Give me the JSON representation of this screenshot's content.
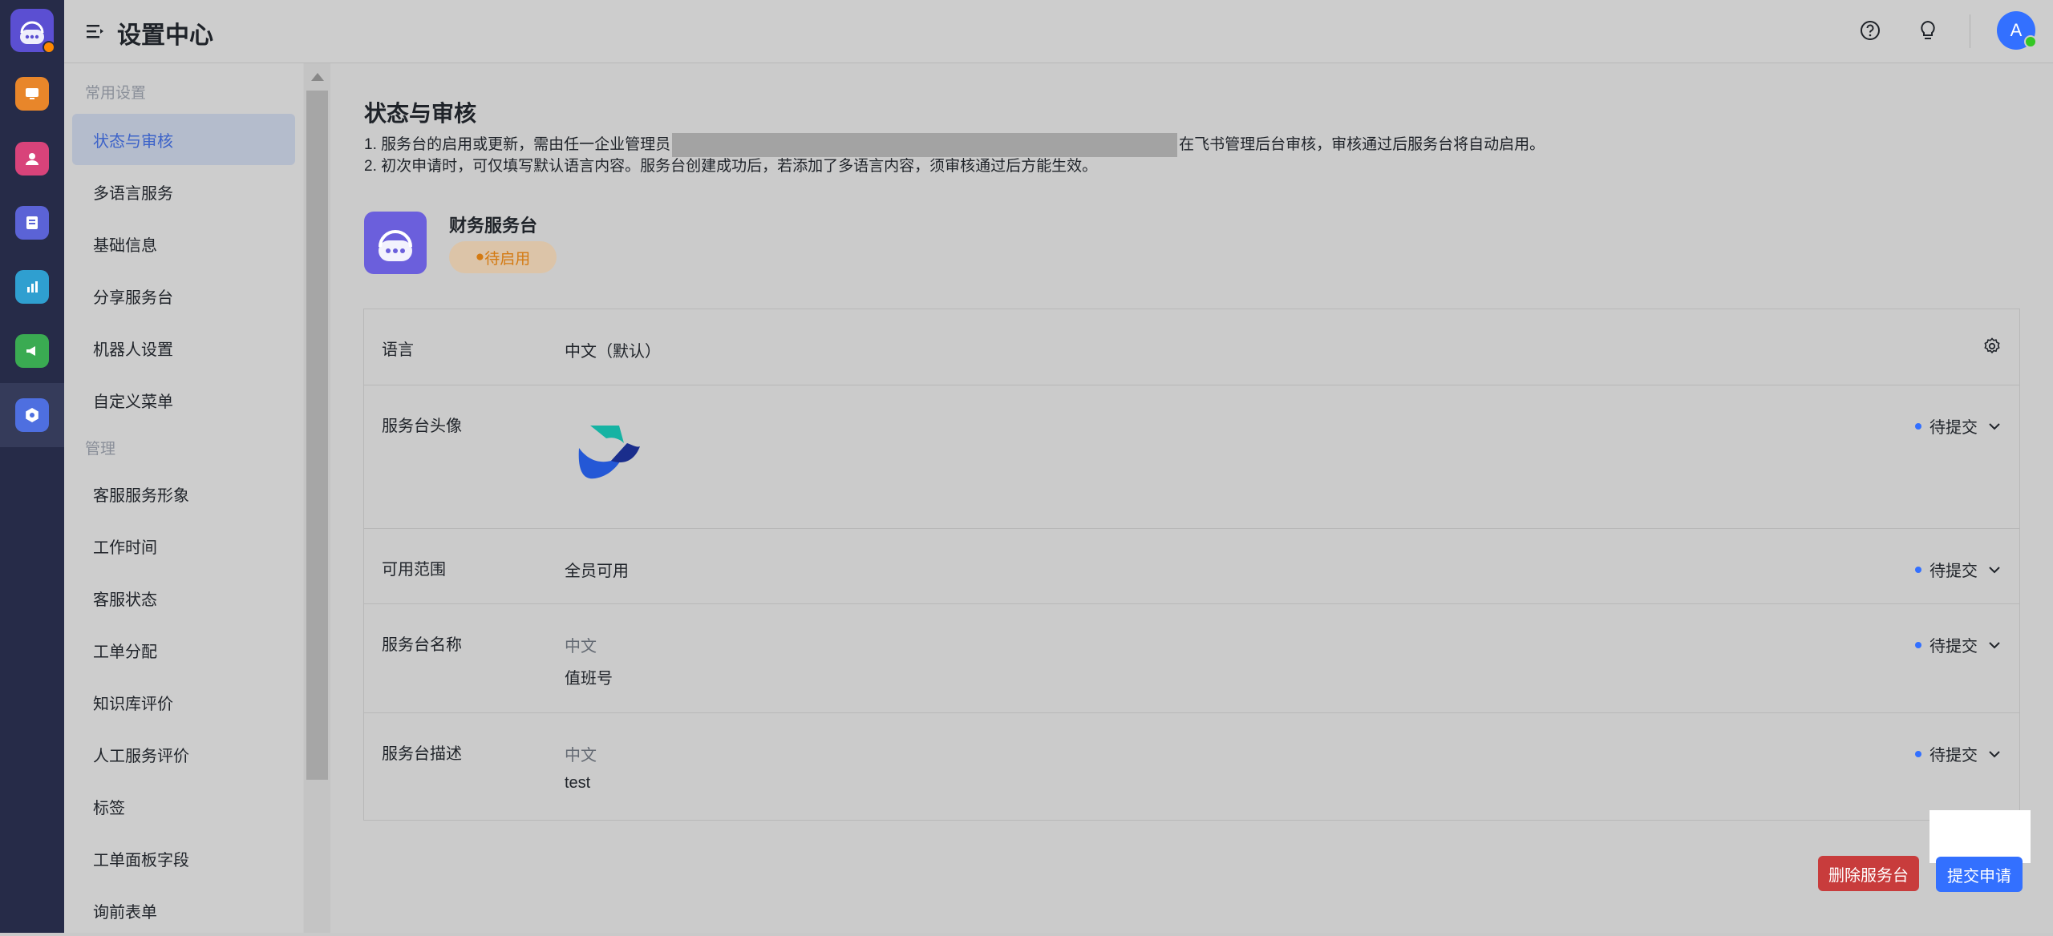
{
  "header": {
    "title": "设置中心"
  },
  "sidebar": {
    "groups": [
      {
        "label": "常用设置"
      },
      {
        "label": "管理"
      }
    ],
    "items": [
      {
        "label": "状态与审核"
      },
      {
        "label": "多语言服务"
      },
      {
        "label": "基础信息"
      },
      {
        "label": "分享服务台"
      },
      {
        "label": "机器人设置"
      },
      {
        "label": "自定义菜单"
      },
      {
        "label": "客服服务形象"
      },
      {
        "label": "工作时间"
      },
      {
        "label": "客服状态"
      },
      {
        "label": "工单分配"
      },
      {
        "label": "知识库评价"
      },
      {
        "label": "人工服务评价"
      },
      {
        "label": "标签"
      },
      {
        "label": "工单面板字段"
      },
      {
        "label": "询前表单"
      }
    ],
    "active_item": "状态与审核"
  },
  "main": {
    "heading": "状态与审核",
    "notes": {
      "line1_before": "1. 服务台的启用或更新，需由任一企业管理员",
      "line1_after": "在飞书管理后台审核，审核通过后服务台将自动启用。",
      "line2": "2. 初次申请时，可仅填写默认语言内容。服务台创建成功后，若添加了多语言内容，须审核通过后方能生效。"
    },
    "app": {
      "name": "财务服务台",
      "status": "待启用",
      "status_color": "#d47a12"
    },
    "rows": [
      {
        "label": "语言",
        "value": "中文（默认）"
      },
      {
        "label": "服务台头像",
        "status": "待提交"
      },
      {
        "label": "可用范围",
        "value": "全员可用",
        "status": "待提交"
      },
      {
        "label": "服务台名称",
        "sub": "中文",
        "value": "值班号",
        "status": "待提交"
      },
      {
        "label": "服务台描述",
        "sub": "中文",
        "value": "test",
        "status": "待提交"
      }
    ],
    "buttons": {
      "delete": "删除服务台",
      "submit": "提交申请"
    }
  },
  "user": {
    "avatar_initial": "A"
  },
  "colors": {
    "accent": "#3370ff",
    "danger": "#c83c3c",
    "rail": "#262b48"
  }
}
